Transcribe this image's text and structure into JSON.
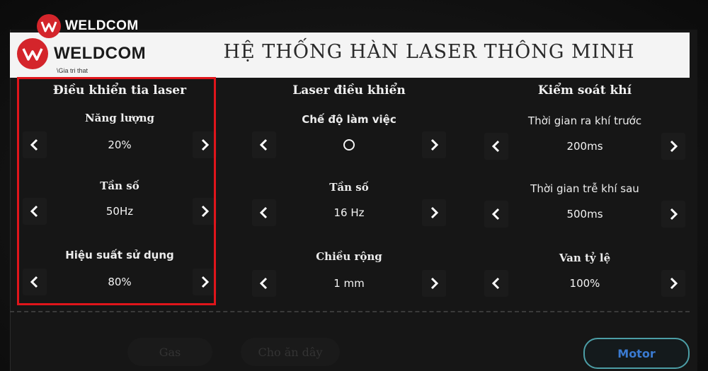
{
  "watermark": {
    "brand": "WELDCOM"
  },
  "header": {
    "brand": "WELDCOM",
    "tagline": "\\Gia tri that",
    "title": "HỆ THỐNG HÀN LASER THÔNG MINH"
  },
  "panels": [
    {
      "title": "Điều khiển tia laser",
      "fields": [
        {
          "label": "Năng lượng",
          "value": "20%"
        },
        {
          "label": "Tần số",
          "value": "50Hz"
        },
        {
          "label": "Hiệu suất sử dụng",
          "value": "80%"
        }
      ]
    },
    {
      "title": "Laser điều khiển",
      "fields": [
        {
          "label": "Chế độ làm việc",
          "value": "O"
        },
        {
          "label": "Tần số",
          "value": "16 Hz"
        },
        {
          "label": "Chiều rộng",
          "value": "1 mm"
        }
      ]
    },
    {
      "title": "Kiểm soát khí",
      "fields": [
        {
          "label": "Thời gian ra khí trước",
          "value": "200ms"
        },
        {
          "label": "Thời gian trễ khí sau",
          "value": "500ms"
        },
        {
          "label": "Van tỷ lệ",
          "value": "100%"
        }
      ]
    }
  ],
  "nav": {
    "gas": "Gas",
    "wire_feeder": "Cho ăn dây",
    "motor": "Motor"
  },
  "colors": {
    "brand_red": "#d4252b",
    "highlight_red": "#e0151b",
    "motor_accent": "#3a7ad0"
  }
}
